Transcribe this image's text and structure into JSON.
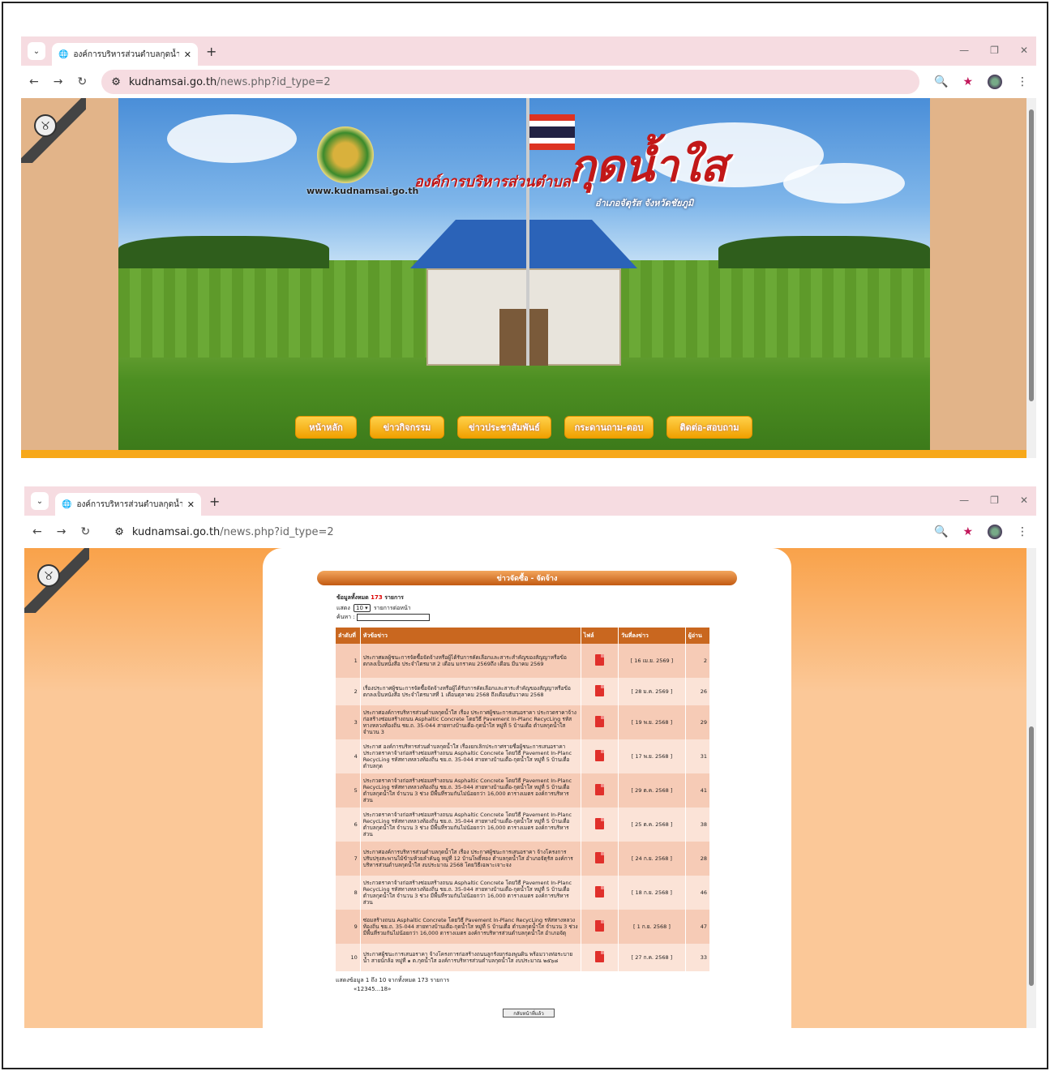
{
  "browser": {
    "tab_title": "องค์การบริหารส่วนตำบลกุดน้ำใส อำเ",
    "url_domain": "kudnamsai.go.th",
    "url_path": "/news.php?id_type=2"
  },
  "banner": {
    "site_url": "www.kudnamsai.go.th",
    "org_prefix": "องค์การบริหารส่วนตำบล",
    "org_name": "กุดน้ำใส",
    "district": "อำเภอจัตุรัส จังหวัดชัยภูมิ",
    "menu": [
      "หน้าหลัก",
      "ข่าวกิจกรรม",
      "ข่าวประชาสัมพันธ์",
      "กระดานถาม-ตอบ",
      "ติดต่อ-สอบถาม"
    ]
  },
  "news": {
    "heading": "ข่าวจัดซื้อ - จัดจ้าง",
    "total_label": "ข้อมูลทั้งหมด",
    "total_count": "173",
    "total_unit": "รายการ",
    "show_label": "แสดง",
    "page_size": "10",
    "per_page_label": "รายการต่อหน้า",
    "search_label": "ค้นหา :",
    "columns": [
      "ลำดับที่",
      "หัวข้อข่าว",
      "ไฟล์",
      "วันที่ลงข่าว",
      "ผู้อ่าน"
    ],
    "rows": [
      {
        "no": "1",
        "title": "ประกาศผลผู้ชนะการจัดซื้อจัดจ้างหรือผู้ได้รับการคัดเลือกและสาระสำคัญของสัญญาหรือข้อตกลงเป็นหนังสือ ประจำไตรมาส 2 เดือน มกราคม 2569ถึง เดือน มีนาคม 2569",
        "date": "[ 16 เม.ย. 2569 ]",
        "reads": "2"
      },
      {
        "no": "2",
        "title": "เรื่องประกาศผู้ชนะการจัดซื้อจัดจ้างหรือผู้ได้รับการคัดเลือกและสาระสำคัญของสัญญาหรือข้อตกลงเป็นหนังสือ ประจำไตรมาสที่ 1 เดือนตุลาคม 2568 ถึงเดือนธันวาคม 2568",
        "date": "[ 28 ม.ค. 2569 ]",
        "reads": "26"
      },
      {
        "no": "3",
        "title": "ประกาศองค์การบริหารส่วนตำบลกุดน้ำใส เรื่อง ประกาศผู้ชนะการเสนอราคา ประกวดราคาจ้างก่อสร้างซ่อมสร้างถนน Asphaltic Concrete โดยวิธี Pavement In-Planc RecycLing รหัสทางหลวงท้องถิ่น ชย.ถ. 35-044 สายทางบ้านเตื่อ-กุดน้ำใส หมู่ที่ 5 บ้านเตื่อ ตำบลกุดน้ำใส จำนวน 3",
        "date": "[ 19 พ.ย. 2568 ]",
        "reads": "29"
      },
      {
        "no": "4",
        "title": "ประกาศ องค์การบริหารส่วนตำบลกุดน้ำใส เรื่องยกเลิกประกาศรายชื่อผู้ชนะการเสนอราคา ประกวดราคาจ้างก่อสร้างซ่อมสร้างถนน Asphaltic Concrete โดยวิธี Pavement In-Planc RecycLing รหัสทางหลวงท้องถิ่น ชย.ถ. 35-044 สายทางบ้านเตื่อ-กุดน้ำใส หมู่ที่ 5 บ้านเตื่อ ตำบลกุด",
        "date": "[ 17 พ.ย. 2568 ]",
        "reads": "31"
      },
      {
        "no": "5",
        "title": "ประกวดราคาจ้างก่อสร้างซ่อมสร้างถนน Asphaltic Concrete โดยวิธี Pavement In-Planc RecycLing รหัสทางหลวงท้องถิ่น ชย.ถ. 35-044 สายทางบ้านเตื่อ-กุดน้ำใส หมู่ที่ 5 บ้านเตื่อ ตำบลกุดน้ำใส จำนวน 3 ช่วง มีพื้นที่รวมกันไม่น้อยกว่า 16,000 ตารางเมตร องค์การบริหารส่วน",
        "date": "[ 29 ต.ค. 2568 ]",
        "reads": "41"
      },
      {
        "no": "6",
        "title": "ประกวดราคาจ้างก่อสร้างซ่อมสร้างถนน Asphaltic Concrete โดยวิธี Pavement In-Planc RecycLing รหัสทางหลวงท้องถิ่น ชย.ถ. 35-044 สายทางบ้านเตื่อ-กุดน้ำใส หมู่ที่ 5 บ้านเตื่อ ตำบลกุดน้ำใส จำนวน 3 ช่วง มีพื้นที่รวมกันไม่น้อยกว่า 16,000 ตารางเมตร องค์การบริหารส่วน",
        "date": "[ 25 ต.ค. 2568 ]",
        "reads": "38"
      },
      {
        "no": "7",
        "title": "ประกาศองค์การบริหารส่วนตำบลกุดน้ำใส เรื่อง ประกาศผู้ชนะการเสนอราคา จ้างโครงการปรับปรุงสะพานไม้ข้ามห้วยลำคันฉู หมู่ที่ 12 บ้านโพธิ์ทอง ตำบลกุดน้ำใส อำเภอจัตุรัส องค์การบริหารส่วนตำบลกุดน้ำใส งบประมาณ 2568 โดยวิธีเฉพาะเจาะจง",
        "date": "[ 24 ก.ย. 2568 ]",
        "reads": "28"
      },
      {
        "no": "8",
        "title": "ประกวดราคาจ้างก่อสร้างซ่อมสร้างถนน Asphaltic Concrete โดยวิธี Pavement In-Planc RecycLing รหัสทางหลวงท้องถิ่น ชย.ถ. 35-044 สายทางบ้านเตื่อ-กุดน้ำใส หมู่ที่ 5 บ้านเตื่อ ตำบลกุดน้ำใส จำนวน 3 ช่วง มีพื้นที่รวมกันไม่น้อยกว่า 16,000 ตารางเมตร องค์การบริหารส่วน",
        "date": "[ 18 ก.ย. 2568 ]",
        "reads": "46"
      },
      {
        "no": "9",
        "title": "ซ่อมสร้างถนน Asphaltic Concrete โดยวิธี Pavement In-Planc RecycLing รหัสทางหลวงท้องถิ่น ชย.ถ. 35-044 สายทางบ้านเตื่อ-กุดน้ำใส หมู่ที่ 5 บ้านเตื่อ ตำบลกุดน้ำใส จำนวน 3 ช่วง มีพื้นที่รวมกันไม่น้อยกว่า 16,000 ตารางเมตร องค์การบริหารส่วนตำบลกุดน้ำใส อำเภอจัตุ",
        "date": "[ 1 ก.ย. 2568 ]",
        "reads": "47"
      },
      {
        "no": "10",
        "title": "ประกาศผู้ชนะการเสนอราคา จ้างโครงการก่อสร้างถนนลูกรังยกร่องพูนดิน พร้อมวางท่อระบายน้ำ สายนักล้อ หมู่ที่ ๑ ต.กุดน้ำใส องค์การบริหารส่วนตำบลกุดน้ำใส งบประมาณ ๒๕๖๘",
        "date": "[ 27 ก.ค. 2568 ]",
        "reads": "33"
      }
    ],
    "footer_summary": "แสดงข้อมูล 1 ถึง 10 จากทั้งหมด 173 รายการ",
    "pagination": "«12345...18»",
    "back_button": "กลับหน้าที่แล้ว"
  }
}
